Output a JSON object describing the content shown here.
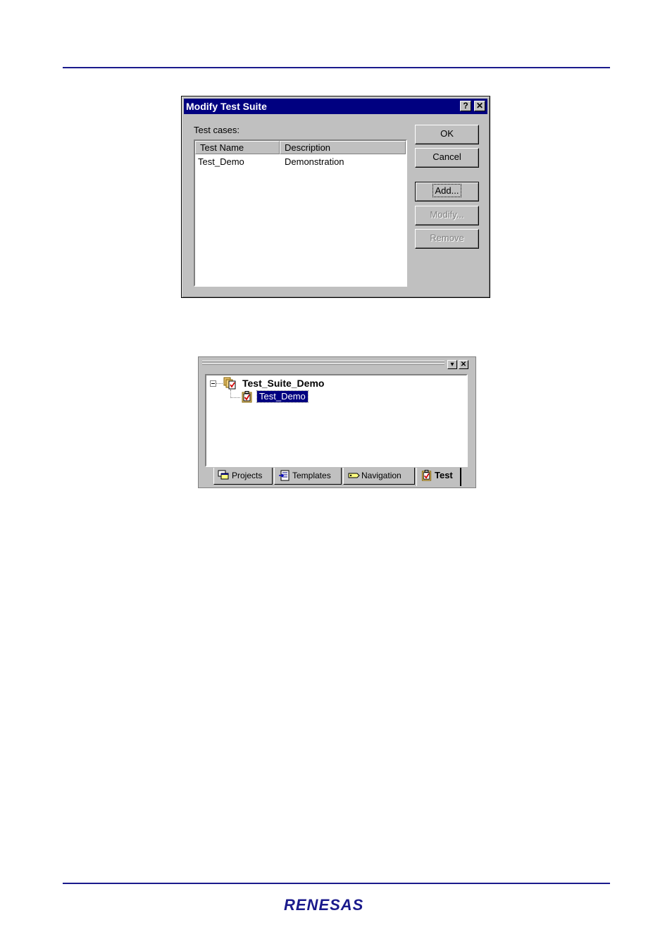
{
  "dialog": {
    "title": "Modify Test Suite",
    "help_glyph": "?",
    "close_glyph": "✕",
    "test_cases_label": "Test cases:",
    "columns": [
      "Test Name",
      "Description"
    ],
    "rows": [
      {
        "name": "Test_Demo",
        "description": "Demonstration"
      }
    ],
    "buttons": {
      "ok": "OK",
      "cancel": "Cancel",
      "add": "Add...",
      "modify": "Modify...",
      "remove": "Remove"
    },
    "focused_button": "add",
    "disabled_buttons": [
      "modify",
      "remove"
    ]
  },
  "workspace": {
    "menu_glyph": "▾",
    "close_glyph": "✕",
    "tree": {
      "suite": "Test_Suite_Demo",
      "test": "Test_Demo"
    },
    "tabs": [
      {
        "label": "Projects",
        "icon": "projects-icon"
      },
      {
        "label": "Templates",
        "icon": "templates-icon"
      },
      {
        "label": "Navigation",
        "icon": "navigation-icon"
      },
      {
        "label": "Test",
        "icon": "test-icon",
        "active": true
      }
    ]
  },
  "footer": {
    "logo_text": "RENESAS"
  },
  "colors": {
    "rule": "#1a1a8c",
    "titlebar": "#000080",
    "selection": "#000080",
    "logo": "#1a1a8c"
  }
}
